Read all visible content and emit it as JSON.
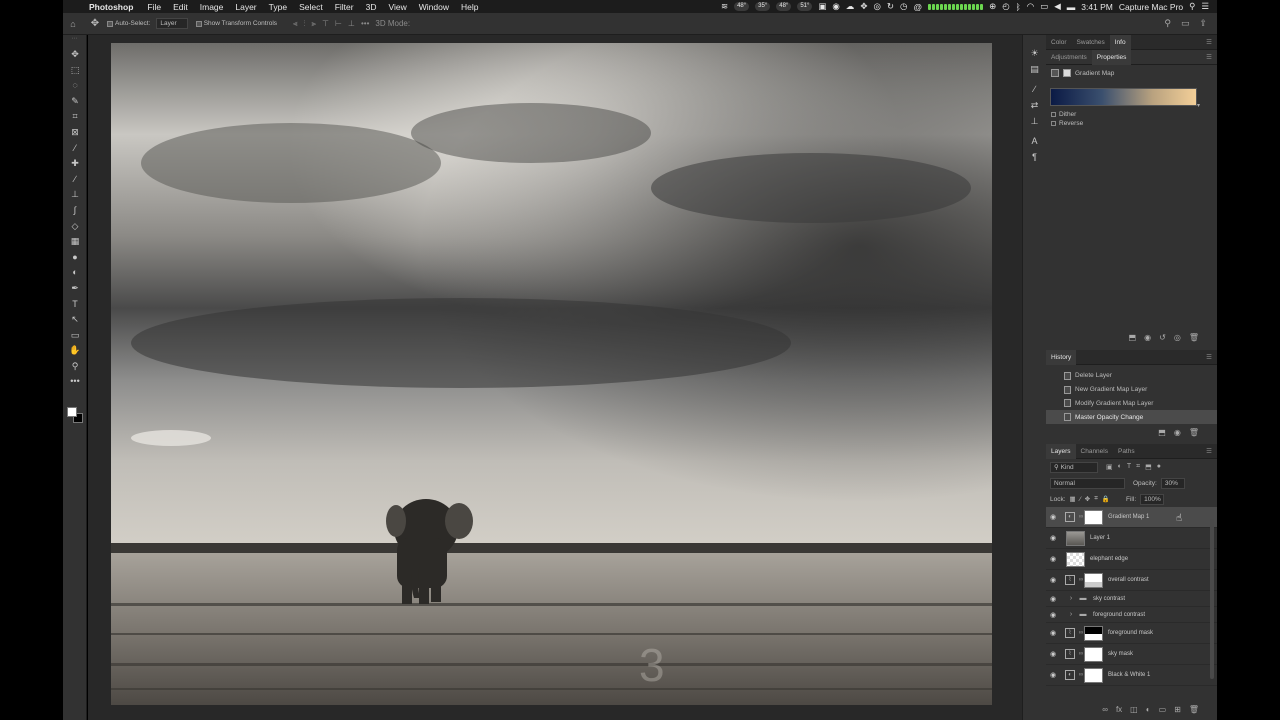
{
  "menubar": {
    "apple": "",
    "app_name": "Photoshop",
    "items": [
      "File",
      "Edit",
      "Image",
      "Layer",
      "Type",
      "Select",
      "Filter",
      "3D",
      "View",
      "Window",
      "Help"
    ],
    "status_pills": [
      "48°",
      "35°",
      "48°",
      "51°"
    ],
    "time": "3:41 PM",
    "user": "Capture Mac Pro"
  },
  "options_bar": {
    "auto_select_label": "Auto-Select:",
    "auto_select_value": "Layer",
    "transform_label": "Show Transform Controls",
    "mode_label": "3D Mode:"
  },
  "tools": [
    {
      "icon": "move-tool-icon",
      "glyph": "✥"
    },
    {
      "icon": "marquee-tool-icon",
      "glyph": "⬚"
    },
    {
      "icon": "lasso-tool-icon",
      "glyph": "◌"
    },
    {
      "icon": "quick-select-tool-icon",
      "glyph": "✎"
    },
    {
      "icon": "crop-tool-icon",
      "glyph": "⌗"
    },
    {
      "icon": "frame-tool-icon",
      "glyph": "⊠"
    },
    {
      "icon": "eyedropper-tool-icon",
      "glyph": "⁄"
    },
    {
      "icon": "healing-tool-icon",
      "glyph": "✚"
    },
    {
      "icon": "brush-tool-icon",
      "glyph": "∕"
    },
    {
      "icon": "stamp-tool-icon",
      "glyph": "⊥"
    },
    {
      "icon": "history-brush-tool-icon",
      "glyph": "∫"
    },
    {
      "icon": "eraser-tool-icon",
      "glyph": "◇"
    },
    {
      "icon": "gradient-tool-icon",
      "glyph": "▦"
    },
    {
      "icon": "blur-tool-icon",
      "glyph": "●"
    },
    {
      "icon": "dodge-tool-icon",
      "glyph": "◐"
    },
    {
      "icon": "pen-tool-icon",
      "glyph": "✒"
    },
    {
      "icon": "type-tool-icon",
      "glyph": "T"
    },
    {
      "icon": "path-select-tool-icon",
      "glyph": "↖"
    },
    {
      "icon": "shape-tool-icon",
      "glyph": "▭"
    },
    {
      "icon": "hand-tool-icon",
      "glyph": "✋"
    },
    {
      "icon": "zoom-tool-icon",
      "glyph": "⚲"
    },
    {
      "icon": "more-tools-icon",
      "glyph": "•••"
    }
  ],
  "panel_tabs_top": {
    "tabs": [
      "Color",
      "Swatches",
      "Info"
    ],
    "active": "Info"
  },
  "properties": {
    "tabs": [
      "Adjustments",
      "Properties"
    ],
    "active": "Properties",
    "title": "Gradient Map",
    "options": [
      "Dither",
      "Reverse"
    ],
    "gradient_colors": [
      "#0b1a45",
      "#3a4f6e",
      "#b9a27f",
      "#f3cf98"
    ]
  },
  "history": {
    "title": "History",
    "items": [
      "Delete Layer",
      "New Gradient Map Layer",
      "Modify Gradient Map Layer",
      "Master Opacity Change"
    ],
    "selected_index": 3
  },
  "layers": {
    "tabs": [
      "Layers",
      "Channels",
      "Paths"
    ],
    "active": "Layers",
    "kind_label": "Kind",
    "blend_mode": "Normal",
    "opacity_label": "Opacity:",
    "opacity_value": "30%",
    "lock_label": "Lock:",
    "fill_label": "Fill:",
    "fill_value": "100%",
    "items": [
      {
        "name": "Gradient Map 1",
        "type": "adjustment"
      },
      {
        "name": "Layer 1",
        "type": "pixel"
      },
      {
        "name": "elephant edge",
        "type": "transparent"
      },
      {
        "name": "overall contrast",
        "type": "curves"
      },
      {
        "name": "sky contrast",
        "type": "group"
      },
      {
        "name": "foreground contrast",
        "type": "group"
      },
      {
        "name": "foreground mask",
        "type": "curves"
      },
      {
        "name": "sky mask",
        "type": "curves"
      },
      {
        "name": "Black & White 1",
        "type": "adjustment"
      }
    ]
  },
  "document": {
    "watermark": "3"
  }
}
